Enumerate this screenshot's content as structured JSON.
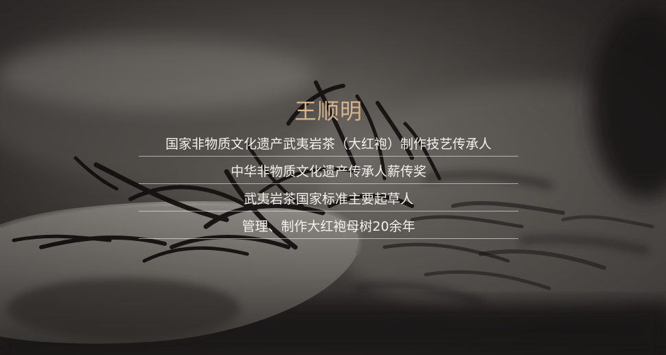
{
  "profile": {
    "name": "王顺明",
    "titles": [
      "国家非物质文化遗产武夷岩茶（大红袍）制作技艺传承人",
      "中华非物质文化遗产传承人薪传奖",
      "武夷岩茶国家标准主要起草人",
      "管理、制作大红袍母树20余年"
    ]
  },
  "colors": {
    "name": "#d7b48c",
    "text": "#f4f1ec",
    "divider": "#ffffff"
  }
}
